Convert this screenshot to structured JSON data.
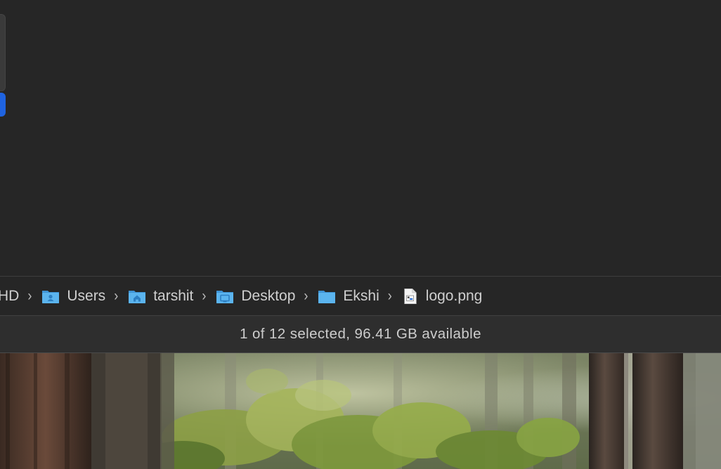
{
  "path_bar": {
    "items": [
      {
        "label": "HD",
        "icon": "drive-icon"
      },
      {
        "label": "Users",
        "icon": "users-folder-icon"
      },
      {
        "label": "tarshit",
        "icon": "home-folder-icon"
      },
      {
        "label": "Desktop",
        "icon": "desktop-folder-icon"
      },
      {
        "label": "Ekshi",
        "icon": "folder-icon"
      },
      {
        "label": "logo.png",
        "icon": "image-file-icon"
      }
    ]
  },
  "status_bar": {
    "text": "1 of 12 selected, 96.41 GB available"
  },
  "colors": {
    "window_bg": "#262626",
    "status_bg": "#2e2e2e",
    "selection_accent": "#1f63e0",
    "folder_blue": "#4aa8e8"
  }
}
